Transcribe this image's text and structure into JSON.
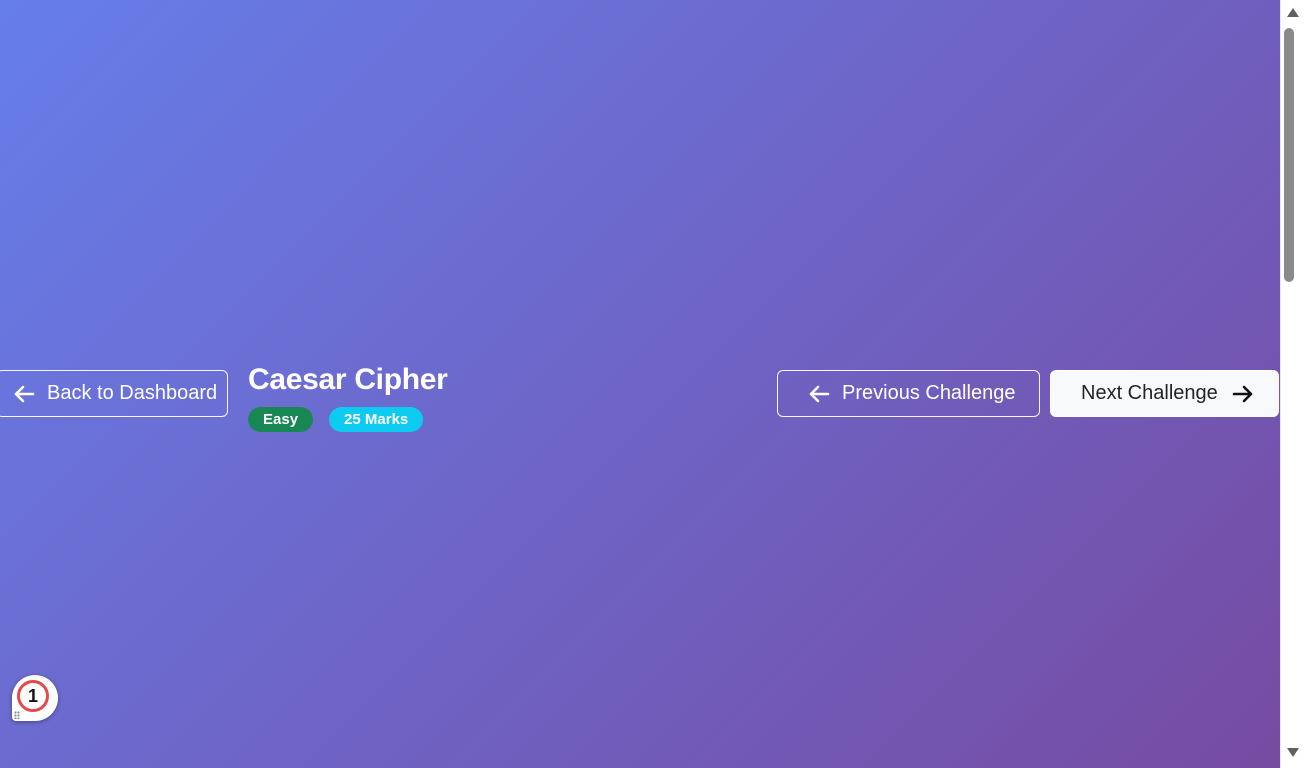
{
  "header": {
    "back_label": "Back to Dashboard",
    "challenge_title": "Caesar Cipher",
    "difficulty_badge": "Easy",
    "marks_badge": "25 Marks",
    "prev_label": "Previous Challenge",
    "next_label": "Next Challenge"
  },
  "notification": {
    "count": "1"
  },
  "icons": {
    "back": "arrow-left-icon",
    "prev": "arrow-left-icon",
    "next": "arrow-right-icon"
  },
  "colors": {
    "gradient_start": "#667eea",
    "gradient_end": "#764ba2",
    "easy_badge": "#198754",
    "marks_badge": "#0dcaf0",
    "notification_ring": "#e5484d"
  }
}
